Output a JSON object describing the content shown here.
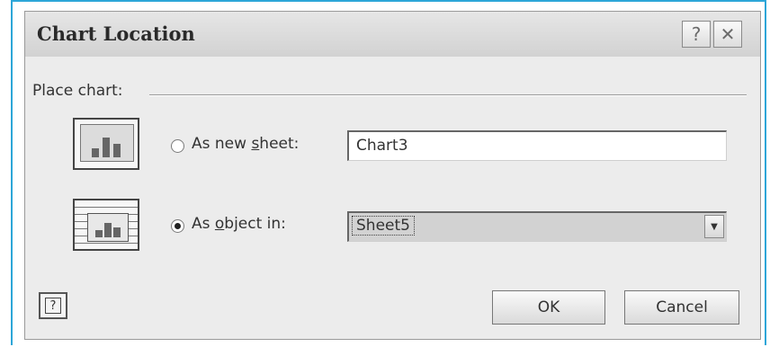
{
  "dialog": {
    "title": "Chart Location",
    "help_button_glyph": "?",
    "close_button_glyph": "✕"
  },
  "group": {
    "label": "Place chart:"
  },
  "options": [
    {
      "label_before": "As new ",
      "label_accel": "s",
      "label_after": "heet:",
      "selected": false,
      "value": "Chart3",
      "icon": "chart-sheet-icon"
    },
    {
      "label_before": "As ",
      "label_accel": "o",
      "label_after": "bject in:",
      "selected": true,
      "value": "Sheet5",
      "icon": "embedded-chart-icon"
    }
  ],
  "buttons": {
    "ok": "OK",
    "cancel": "Cancel",
    "help_glyph": "?"
  },
  "colors": {
    "frame": "#2da6d8",
    "dialog_bg": "#ececec"
  }
}
